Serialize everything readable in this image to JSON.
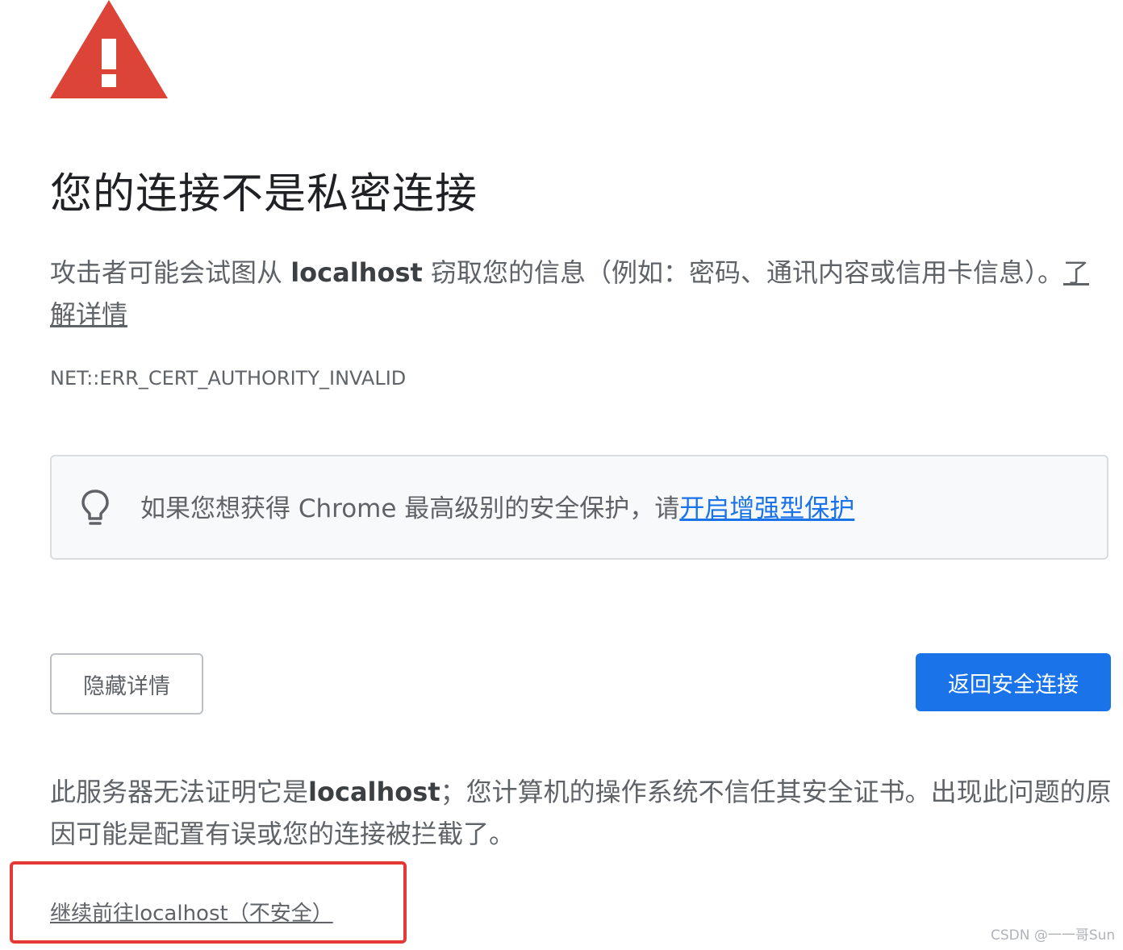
{
  "icons": {
    "warning": "warning-triangle-icon",
    "lightbulb": "lightbulb-icon"
  },
  "colors": {
    "warning_red": "#db4437",
    "primary_blue": "#1a73e8",
    "highlight_red": "#e53935"
  },
  "heading": {
    "title": "您的连接不是私密连接"
  },
  "description": {
    "prefix": "攻击者可能会试图从 ",
    "host": "localhost",
    "suffix": " 窃取您的信息（例如：密码、通讯内容或信用卡信息）。",
    "learn_more": "了解详情"
  },
  "error_code": "NET::ERR_CERT_AUTHORITY_INVALID",
  "tip": {
    "text": "如果您想获得 Chrome 最高级别的安全保护，请",
    "link": "开启增强型保护"
  },
  "buttons": {
    "hide_details": "隐藏详情",
    "back_to_safety": "返回安全连接"
  },
  "details": {
    "prefix": "此服务器无法证明它是",
    "host": "localhost",
    "suffix": "；您计算机的操作系统不信任其安全证书。出现此问题的原因可能是配置有误或您的连接被拦截了。"
  },
  "proceed_link": "继续前往localhost（不安全）",
  "watermark": "CSDN @一一哥Sun"
}
